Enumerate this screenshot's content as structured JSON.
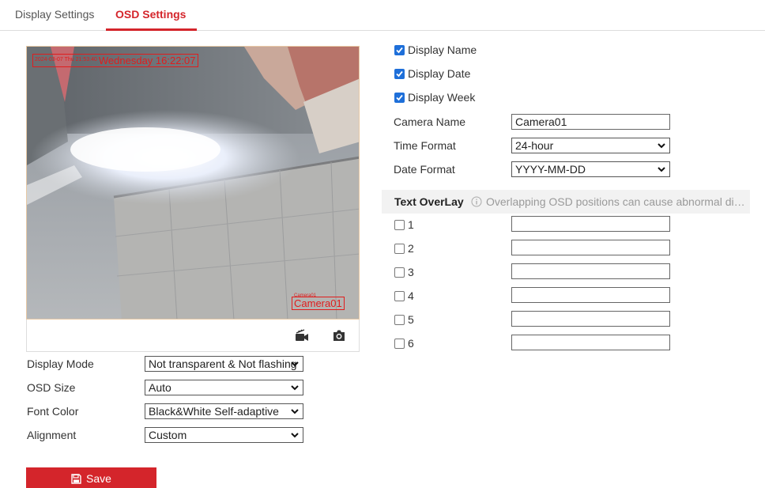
{
  "tabs": [
    {
      "label": "Display Settings"
    },
    {
      "label": "OSD Settings"
    }
  ],
  "active_tab": "OSD Settings",
  "accent_color": "#d4252b",
  "preview": {
    "date_overlay_small": "2024-03-07 Thu 21:53:40",
    "date_overlay": "Wednesday 16:22:07",
    "name_overlay_small": "Camera01",
    "name_overlay": "Camera01",
    "icons": [
      "record-icon",
      "snapshot-icon"
    ]
  },
  "left_form": {
    "display_mode": {
      "label": "Display Mode",
      "value": "Not transparent & Not flashing"
    },
    "osd_size": {
      "label": "OSD Size",
      "value": "Auto"
    },
    "font_color": {
      "label": "Font Color",
      "value": "Black&White Self-adaptive"
    },
    "alignment": {
      "label": "Alignment",
      "value": "Custom"
    }
  },
  "save_label": "Save",
  "right_form": {
    "checkboxes": [
      {
        "label": "Display Name",
        "checked": true
      },
      {
        "label": "Display Date",
        "checked": true
      },
      {
        "label": "Display Week",
        "checked": true
      }
    ],
    "camera_name": {
      "label": "Camera Name",
      "value": "Camera01"
    },
    "time_format": {
      "label": "Time Format",
      "value": "24-hour"
    },
    "date_format": {
      "label": "Date Format",
      "value": "YYYY-MM-DD"
    }
  },
  "text_overlay": {
    "title": "Text OverLay",
    "note": "Overlapping OSD positions can cause abnormal display.",
    "rows": [
      {
        "label": "1",
        "checked": false,
        "value": ""
      },
      {
        "label": "2",
        "checked": false,
        "value": ""
      },
      {
        "label": "3",
        "checked": false,
        "value": ""
      },
      {
        "label": "4",
        "checked": false,
        "value": ""
      },
      {
        "label": "5",
        "checked": false,
        "value": ""
      },
      {
        "label": "6",
        "checked": false,
        "value": ""
      }
    ]
  }
}
